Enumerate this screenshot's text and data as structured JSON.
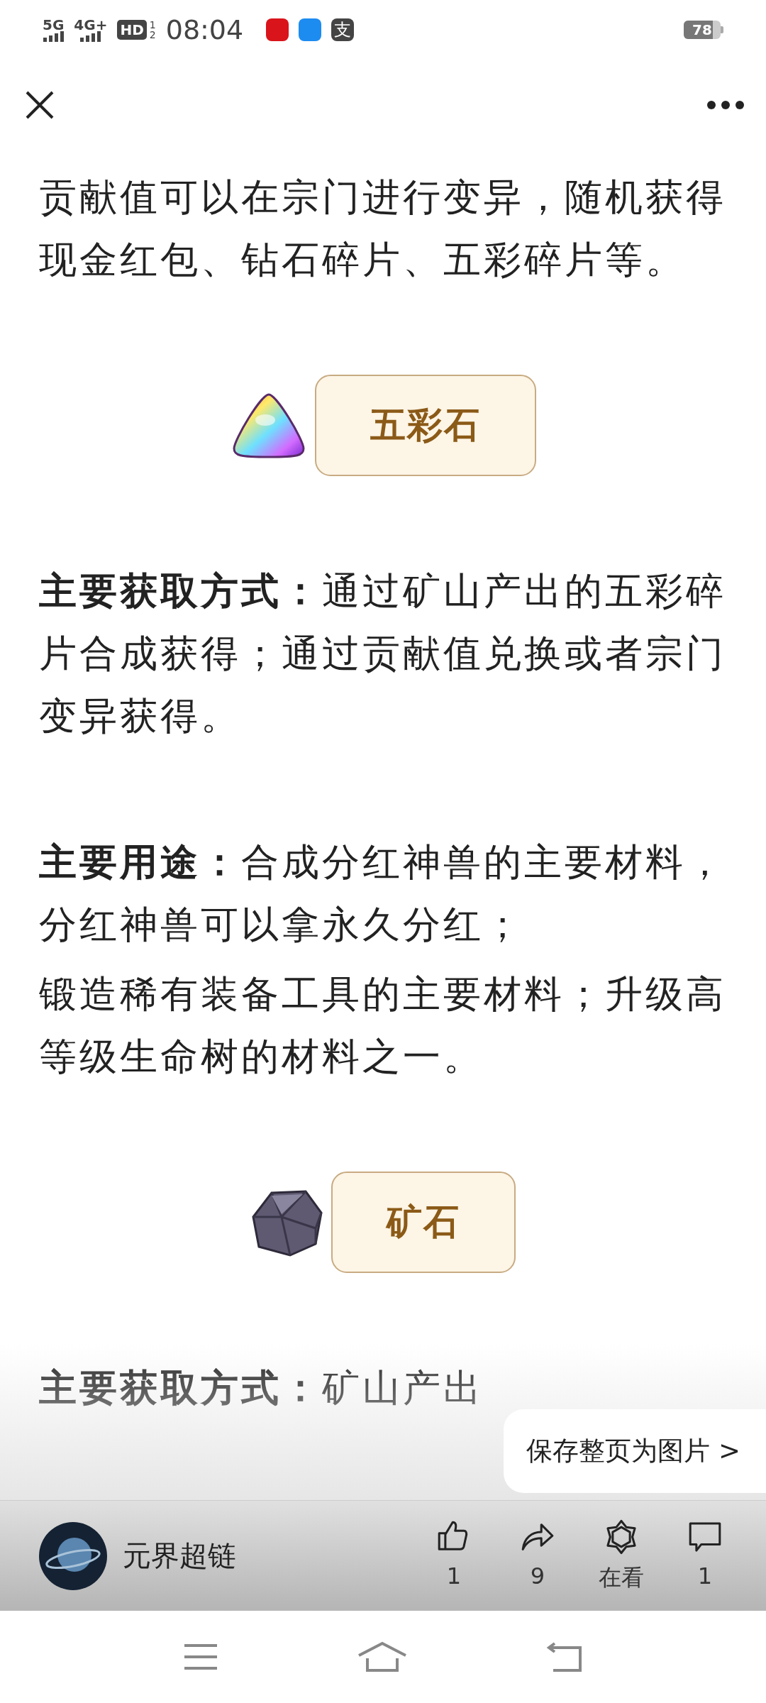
{
  "status_bar": {
    "network_1": "5G",
    "network_2": "4G+",
    "hd_badge": "HD",
    "sim_slots": [
      "1",
      "2"
    ],
    "time": "08:04",
    "app_icons": [
      {
        "kind": "red"
      },
      {
        "kind": "blue"
      },
      {
        "kind": "dark",
        "glyph": "支"
      }
    ],
    "battery": "78"
  },
  "article": [
    {
      "kind": "text",
      "text": "贡献值可以在宗门进行变异，随机获得现金红包、钻石碎片、五彩碎片等。"
    },
    {
      "kind": "banner_gem",
      "label": "五彩石"
    },
    {
      "kind": "text",
      "text": "**主要获取方式：**通过矿山产出的五彩碎片合成获得；通过贡献值兑换或者宗门变异获得。"
    },
    {
      "kind": "text",
      "text": "**主要用途：**合成分红神兽的主要材料，分红神兽可以拿永久分红；"
    },
    {
      "kind": "text_tight",
      "text": "锻造稀有装备工具的主要材料；升级高等级生命树的材料之一。"
    },
    {
      "kind": "banner_ore",
      "label": "矿石"
    },
    {
      "kind": "text",
      "text": "**主要获取方式：**矿山产出"
    }
  ],
  "save_button": "保存整页为图片 >",
  "author": {
    "name": "元界超链"
  },
  "actions": [
    {
      "kind": "like",
      "label": "1"
    },
    {
      "kind": "share",
      "label": "9"
    },
    {
      "kind": "watching",
      "label": "在看"
    },
    {
      "kind": "comment",
      "label": "1"
    }
  ]
}
